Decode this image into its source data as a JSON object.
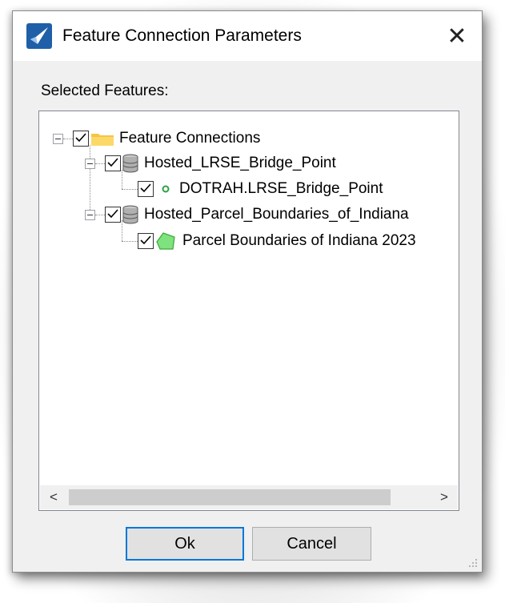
{
  "window": {
    "title": "Feature Connection Parameters",
    "close_glyph": "✕",
    "icon": "app-logo-icon"
  },
  "section_label": "Selected Features:",
  "tree": {
    "root": {
      "label": "Feature Connections",
      "checked": true,
      "expanded": true,
      "icon": "folder-icon"
    },
    "children": [
      {
        "label": "Hosted_LRSE_Bridge_Point",
        "checked": true,
        "expanded": true,
        "icon": "database-icon",
        "children": [
          {
            "label": "DOTRAH.LRSE_Bridge_Point",
            "checked": true,
            "icon": "point-layer-icon"
          }
        ]
      },
      {
        "label": "Hosted_Parcel_Boundaries_of_Indiana",
        "checked": true,
        "expanded": true,
        "icon": "database-icon",
        "children": [
          {
            "label": "Parcel Boundaries of Indiana 2023",
            "checked": true,
            "icon": "polygon-layer-icon"
          }
        ]
      }
    ]
  },
  "scrollbar": {
    "left_arrow": "<",
    "right_arrow": ">"
  },
  "buttons": {
    "ok": "Ok",
    "cancel": "Cancel"
  },
  "colors": {
    "accent": "#0078d7",
    "point": "#2ea043",
    "polygon": "#7ee27e"
  }
}
